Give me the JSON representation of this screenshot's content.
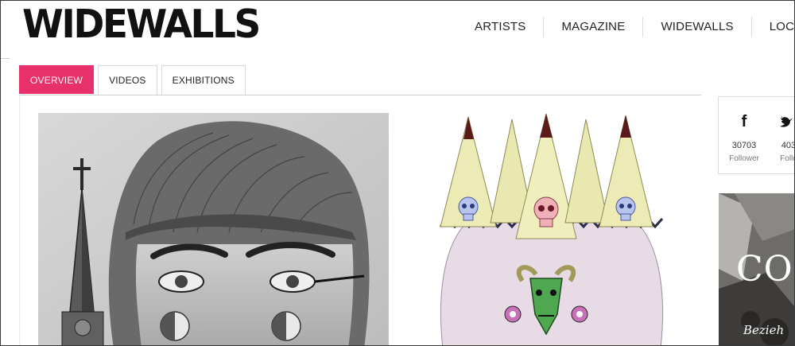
{
  "brand": {
    "logo": "WIDEWALLS"
  },
  "nav": {
    "items": [
      "ARTISTS",
      "MAGAZINE",
      "WIDEWALLS",
      "LOCATO"
    ]
  },
  "tabs": {
    "items": [
      "OVERVIEW",
      "VIDEOS",
      "EXHIBITIONS"
    ],
    "active": "OVERVIEW"
  },
  "social": {
    "facebook": {
      "icon": "facebook-icon",
      "count": "30703",
      "label": "Follower"
    },
    "twitter": {
      "icon": "twitter-icon",
      "count": "403",
      "label": "Follo"
    }
  },
  "ad": {
    "title": "CO",
    "subtitle": "Bezieh"
  },
  "colors": {
    "accent": "#e8306a",
    "text": "#222222",
    "border": "#d9d9d9"
  }
}
